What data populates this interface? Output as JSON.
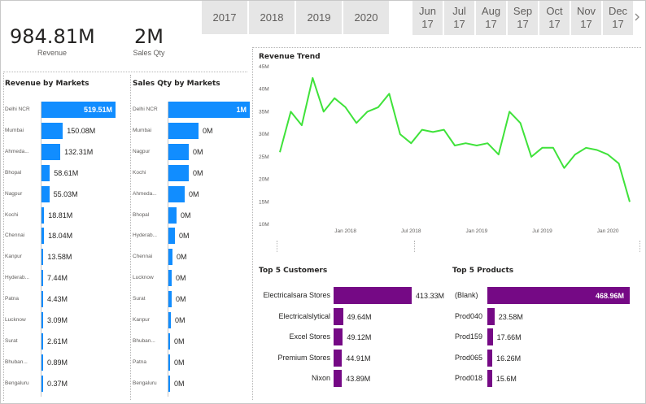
{
  "kpis": [
    {
      "value": "984.81M",
      "label": "Revenue"
    },
    {
      "value": "2M",
      "label": "Sales Qty"
    }
  ],
  "year_slicer": [
    "2017",
    "2018",
    "2019",
    "2020"
  ],
  "month_slicer": [
    {
      "month": "Jun",
      "year": "17"
    },
    {
      "month": "Jul",
      "year": "17"
    },
    {
      "month": "Aug",
      "year": "17"
    },
    {
      "month": "Sep",
      "year": "17"
    },
    {
      "month": "Oct",
      "year": "17"
    },
    {
      "month": "Nov",
      "year": "17"
    },
    {
      "month": "Dec",
      "year": "17"
    }
  ],
  "icons": {
    "slicer_next": "chevron-right-icon"
  },
  "colors": {
    "blue_bar": "#118dff",
    "purple_bar": "#750985",
    "line": "#3fe23a",
    "slicer_bg": "#e6e6e6"
  },
  "chart_data": [
    {
      "type": "bar",
      "title": "Revenue by Markets",
      "categories": [
        "Delhi NCR",
        "Mumbai",
        "Ahmeda...",
        "Bhopal",
        "Nagpur",
        "Kochi",
        "Chennai",
        "Kanpur",
        "Hyderab...",
        "Patna",
        "Lucknow",
        "Surat",
        "Bhuban...",
        "Bengaluru"
      ],
      "values": [
        519.51,
        150.08,
        132.31,
        58.61,
        55.03,
        18.81,
        18.04,
        13.58,
        7.44,
        4.43,
        3.09,
        2.61,
        0.89,
        0.37
      ],
      "labels": [
        "519.51M",
        "150.08M",
        "132.31M",
        "58.61M",
        "55.03M",
        "18.81M",
        "18.04M",
        "13.58M",
        "7.44M",
        "4.43M",
        "3.09M",
        "2.61M",
        "0.89M",
        "0.37M"
      ]
    },
    {
      "type": "bar",
      "title": "Sales Qty by Markets",
      "categories": [
        "Delhi NCR",
        "Mumbai",
        "Nagpur",
        "Kochi",
        "Ahmeda...",
        "Bhopal",
        "Hyderab...",
        "Chennai",
        "Lucknow",
        "Surat",
        "Kanpur",
        "Bhuban...",
        "Patna",
        "Bengaluru"
      ],
      "values": [
        1,
        0.37,
        0.25,
        0.25,
        0.2,
        0.1,
        0.08,
        0.05,
        0.04,
        0.04,
        0.03,
        0.02,
        0.02,
        0.02
      ],
      "labels": [
        "1M",
        "0M",
        "0M",
        "0M",
        "0M",
        "0M",
        "0M",
        "0M",
        "0M",
        "0M",
        "0M",
        "0M",
        "0M",
        "0M"
      ]
    },
    {
      "type": "line",
      "title": "Revenue Trend",
      "y_ticks": [
        "45M",
        "40M",
        "35M",
        "30M",
        "25M",
        "20M",
        "15M",
        "10M"
      ],
      "ylim": [
        10,
        45
      ],
      "x_ticks": [
        "Jan 2018",
        "Jul 2018",
        "Jan 2019",
        "Jul 2019",
        "Jan 2020"
      ],
      "x_tick_positions": [
        7,
        13,
        19,
        25,
        31
      ],
      "series": [
        {
          "values": [
            26,
            35,
            32,
            42.5,
            35,
            38,
            36,
            32.5,
            35,
            36,
            39,
            30,
            28,
            31,
            30.5,
            31,
            27.5,
            28,
            27.5,
            28,
            25.5,
            35,
            32.5,
            25,
            27,
            27,
            22.5,
            25.5,
            27,
            26.5,
            25.5,
            23.5,
            15
          ]
        }
      ]
    },
    {
      "type": "bar",
      "title": "Top 5 Customers",
      "categories": [
        "Electricalsara Stores",
        "Electricalslytical",
        "Excel Stores",
        "Premium Stores",
        "Nixon"
      ],
      "values": [
        413.33,
        49.64,
        49.12,
        44.91,
        43.89
      ],
      "labels": [
        "413.33M",
        "49.64M",
        "49.12M",
        "44.91M",
        "43.89M"
      ]
    },
    {
      "type": "bar",
      "title": "Top 5 Products",
      "categories": [
        "(Blank)",
        "Prod040",
        "Prod159",
        "Prod065",
        "Prod018"
      ],
      "values": [
        468.96,
        23.58,
        17.66,
        16.26,
        15.6
      ],
      "labels": [
        "468.96M",
        "23.58M",
        "17.66M",
        "16.26M",
        "15.6M"
      ]
    }
  ]
}
